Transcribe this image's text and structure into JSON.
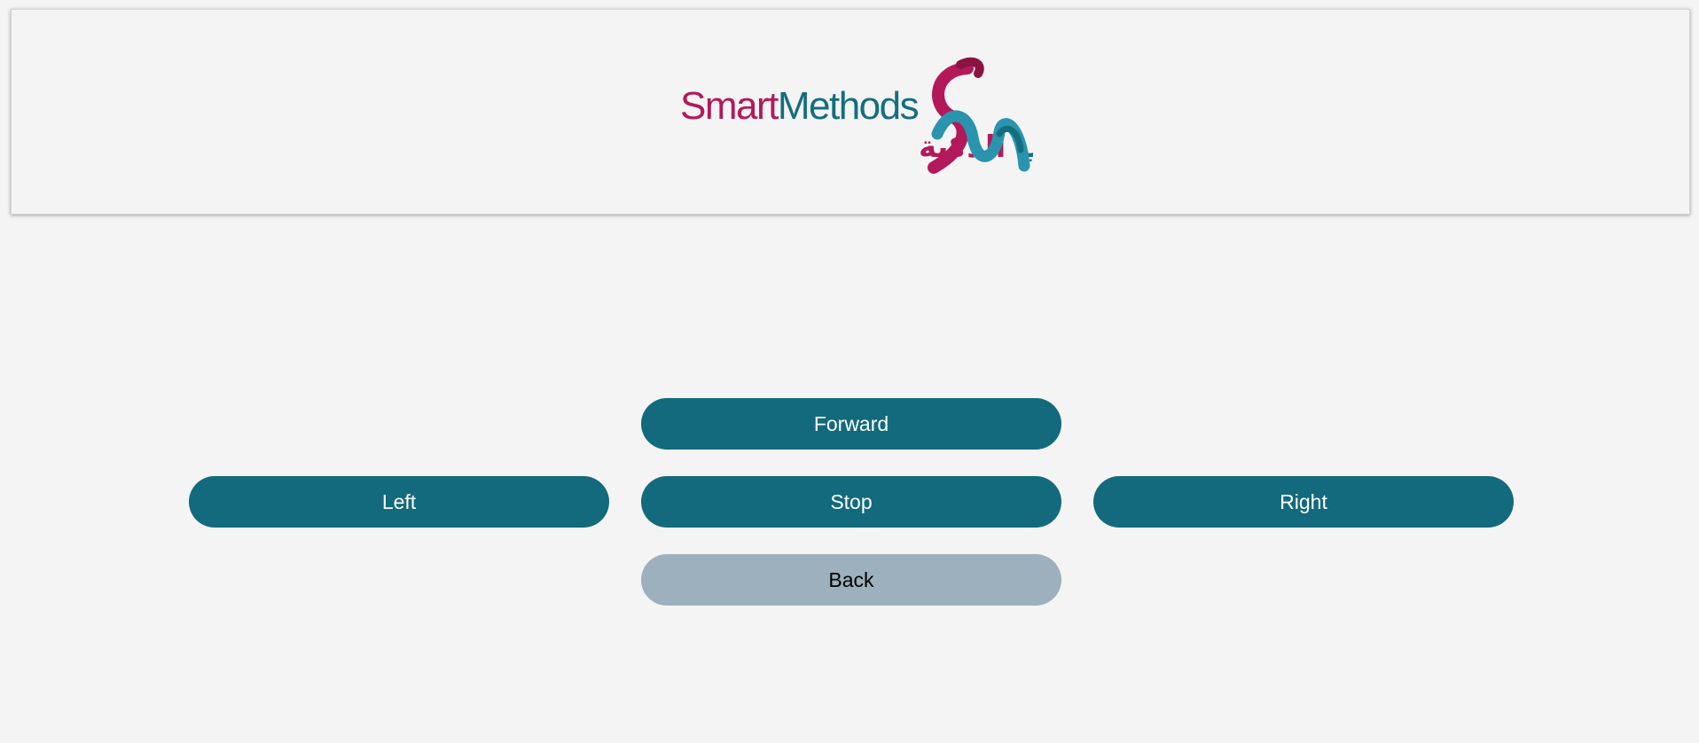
{
  "header": {
    "logo": {
      "name": "smart-methods-logo",
      "text_en": "SmartMethods",
      "text_ar": "الأساليب الذكية",
      "colors": {
        "magenta": "#b3195a",
        "teal": "#136e7f",
        "light_teal": "#2a93ad"
      }
    }
  },
  "controls": {
    "forward_label": "Forward",
    "left_label": "Left",
    "stop_label": "Stop",
    "right_label": "Right",
    "back_label": "Back"
  },
  "colors": {
    "primary_button": "#126a7c",
    "back_button": "#9cb0bd",
    "background": "#f4f4f4"
  }
}
